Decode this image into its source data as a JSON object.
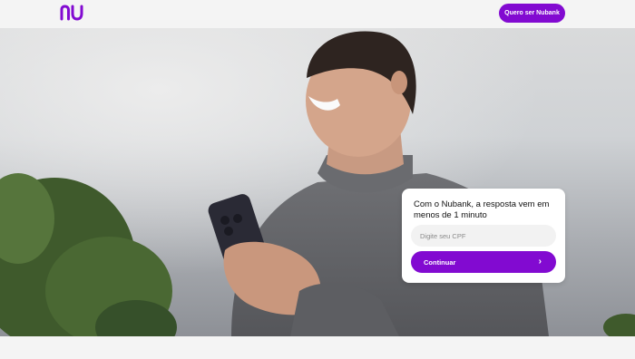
{
  "header": {
    "logo_text": "nu",
    "cta_label": "Quero ser Nubank"
  },
  "signup_card": {
    "title": "Com o Nubank, a resposta vem em menos de 1 minuto",
    "cpf_placeholder": "Digite seu CPF",
    "cpf_value": "",
    "continue_label": "Continuar",
    "continue_icon": "chevron-right-icon"
  },
  "colors": {
    "brand_purple": "#820ad1",
    "background": "#f4f4f4",
    "card": "#ffffff"
  }
}
